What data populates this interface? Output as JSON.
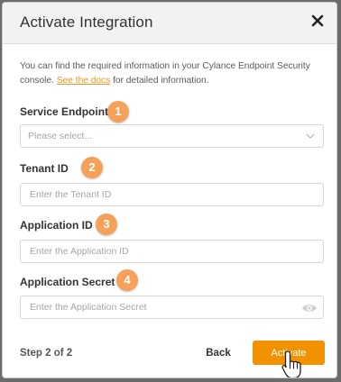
{
  "dialog": {
    "title": "Activate Integration",
    "intro_text": "You can find the required information in your Cylance Endpoint Security console. ",
    "docs_link": "See the docs",
    "intro_suffix": " for detailed information."
  },
  "fields": {
    "service_endpoint": {
      "label": "Service Endpoint",
      "placeholder": "Please select...",
      "badge": "1"
    },
    "tenant_id": {
      "label": "Tenant ID",
      "placeholder": "Enter the Tenant ID",
      "badge": "2"
    },
    "application_id": {
      "label": "Application ID",
      "placeholder": "Enter the Application ID",
      "badge": "3"
    },
    "application_secret": {
      "label": "Application Secret",
      "placeholder": "Enter the Application Secret",
      "badge": "4"
    }
  },
  "footer": {
    "step": "Step 2 of 2",
    "back_label": "Back",
    "activate_label": "Activate"
  },
  "icons": {
    "close": "close-icon",
    "chevron": "chevron-down-icon",
    "eye": "eye-icon",
    "cursor": "hand-pointer-icon"
  },
  "colors": {
    "accent": "#f39200",
    "badge": "#f5a15a",
    "link": "#f7941d"
  }
}
